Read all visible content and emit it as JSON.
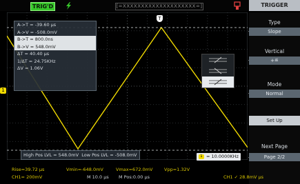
{
  "top": {
    "run_status": "TRIG'D",
    "memory_bar": "[=XXXXXXXXXXXXXXXXXXXX=]"
  },
  "menu": {
    "title": "TRIGGER",
    "type_label": "Type",
    "type_value": "Slope",
    "vertical_label": "Vertical",
    "vertical_value": "+≝",
    "mode_label": "Mode",
    "mode_value": "Normal",
    "setup_label": "Set Up",
    "next_label": "Next Page",
    "page_value": "Page 2/2"
  },
  "measure": {
    "rows": [
      "A->T = -39.60 µs",
      "A->V = -508.0mV",
      "B->T = 800.0ns",
      "B->V = 548.0mV",
      "ΔT = 40.40 µs",
      "1/ΔT = 24.75KHz",
      "ΔV = 1.06V"
    ]
  },
  "markers": {
    "channel": "1",
    "trigger": "T"
  },
  "levels": {
    "high": "High Pos LVL = 548.0mV",
    "low": "Low Pos LVL = -508.0mV"
  },
  "frequency": {
    "icon": "1",
    "value": "= 10.0000KHz"
  },
  "status": {
    "rise": "Rise=39.72 µs",
    "vmin": "Vmin=-648.0mV",
    "vmax": "Vmax=672.0mV",
    "vpp": "Vpp=1.32V",
    "ch1": "CH1= 200mV",
    "mscale": "M 10.0 µs",
    "mpos": "M Pos:0.00 µs",
    "trig": "CH1 ✓ 28.8mV µs"
  },
  "colors": {
    "waveform": "#f0d900",
    "run_badge": "#38c82b",
    "grid": "#3a3f44"
  }
}
